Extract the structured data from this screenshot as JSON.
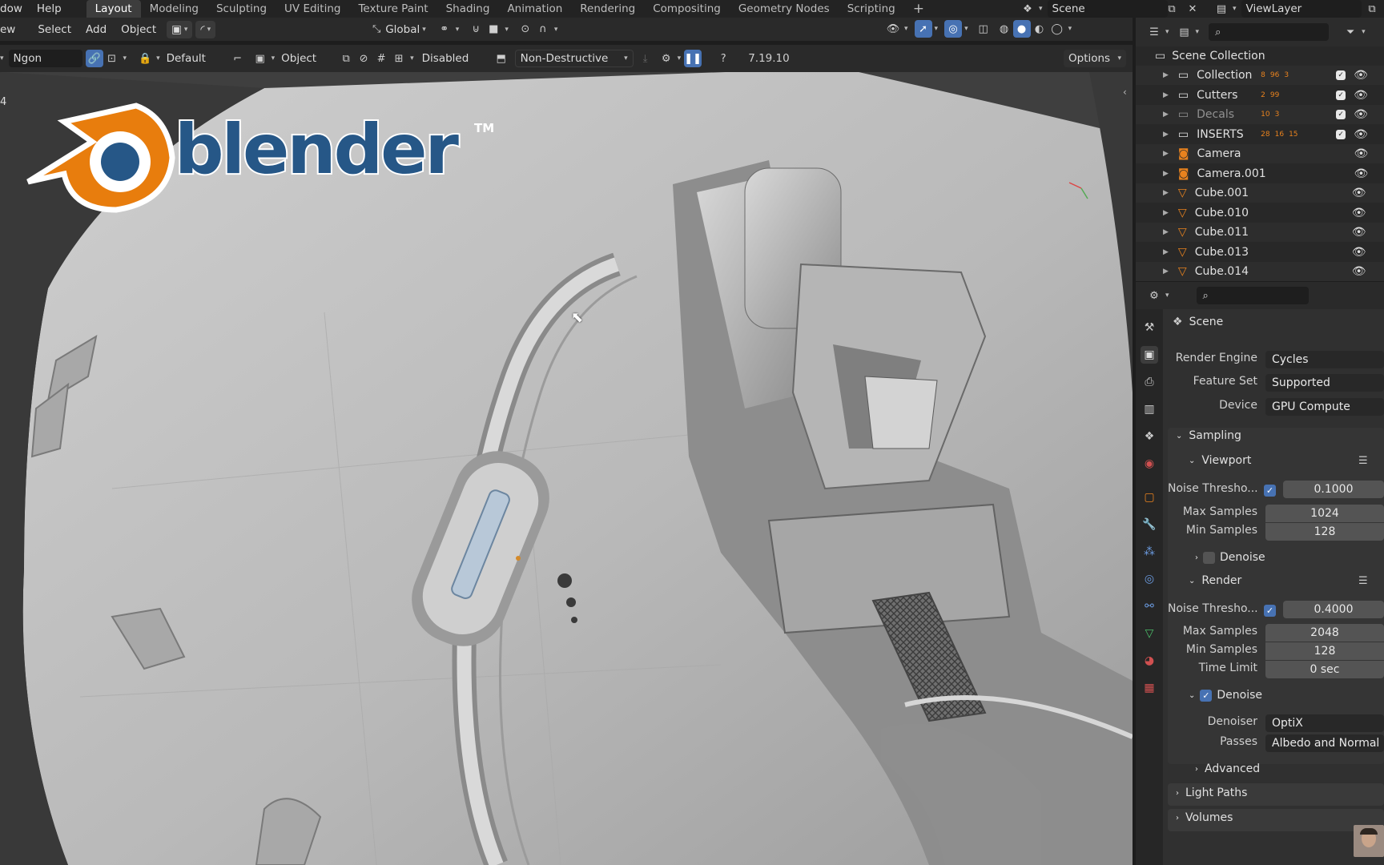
{
  "topbar": {
    "menus": [
      "dow",
      "Help"
    ],
    "workspaces": [
      "Layout",
      "Modeling",
      "Sculpting",
      "UV Editing",
      "Texture Paint",
      "Shading",
      "Animation",
      "Rendering",
      "Compositing",
      "Geometry Nodes",
      "Scripting"
    ],
    "active_workspace": "Layout",
    "add_tab": "+",
    "scene": "Scene",
    "view_layer": "ViewLayer"
  },
  "viewport_header": {
    "menus": [
      "ew",
      "Select",
      "Add",
      "Object"
    ],
    "transform_orientation": "Global"
  },
  "tool_header": {
    "mode": "Ngon",
    "pivot": "Default",
    "target": "Object",
    "snap_mode": "Disabled",
    "boolean_mode": "Non-Destructive",
    "version": "7.19.10",
    "options": "Options"
  },
  "viewport": {
    "logo_word": "blender",
    "logo_tm": "TM",
    "edge_number": "4"
  },
  "outliner": {
    "root": "Scene Collection",
    "items": [
      {
        "name": "Collection",
        "type": "collection",
        "badges": [
          "8",
          "96",
          "3"
        ]
      },
      {
        "name": "Cutters",
        "type": "collection",
        "badges": [
          "2",
          "99"
        ]
      },
      {
        "name": "Decals",
        "type": "collection",
        "badges": [
          "10",
          "3"
        ]
      },
      {
        "name": "INSERTS",
        "type": "collection",
        "badges": [
          "28",
          "16",
          "15"
        ]
      },
      {
        "name": "Camera",
        "type": "camera",
        "badges": []
      },
      {
        "name": "Camera.001",
        "type": "camera",
        "badges": []
      },
      {
        "name": "Cube.001",
        "type": "mesh",
        "badges": []
      },
      {
        "name": "Cube.010",
        "type": "mesh",
        "badges": []
      },
      {
        "name": "Cube.011",
        "type": "mesh",
        "badges": []
      },
      {
        "name": "Cube.013",
        "type": "mesh",
        "badges": []
      },
      {
        "name": "Cube.014",
        "type": "mesh",
        "badges": []
      }
    ]
  },
  "properties": {
    "context": "Scene",
    "render_engine_label": "Render Engine",
    "render_engine": "Cycles",
    "feature_set_label": "Feature Set",
    "feature_set": "Supported",
    "device_label": "Device",
    "device": "GPU Compute",
    "sampling": "Sampling",
    "viewport": {
      "title": "Viewport",
      "noise_label": "Noise Thresho...",
      "noise": "0.1000",
      "max_label": "Max Samples",
      "max": "1024",
      "min_label": "Min Samples",
      "min": "128",
      "denoise": "Denoise"
    },
    "render": {
      "title": "Render",
      "noise_label": "Noise Thresho...",
      "noise": "0.4000",
      "max_label": "Max Samples",
      "max": "2048",
      "min_label": "Min Samples",
      "min": "128",
      "time_label": "Time Limit",
      "time": "0 sec",
      "denoise": "Denoise",
      "denoiser_label": "Denoiser",
      "denoiser": "OptiX",
      "passes_label": "Passes",
      "passes": "Albedo and Normal"
    },
    "advanced": "Advanced",
    "light_paths": "Light Paths",
    "volumes": "Volumes"
  },
  "colors": {
    "accent": "#4772b3",
    "logo_orange": "#e87d0d",
    "logo_blue": "#265787"
  }
}
